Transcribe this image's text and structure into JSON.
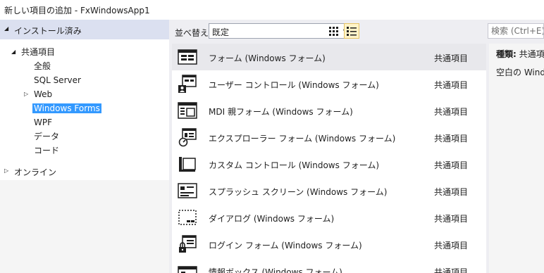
{
  "window": {
    "title": "新しい項目の追加 - FxWindowsApp1"
  },
  "left": {
    "installed_label": "インストール済み",
    "tree": [
      {
        "label": "共通項目",
        "expander": "◢"
      },
      {
        "label": "全般"
      },
      {
        "label": "SQL Server"
      },
      {
        "label": "Web",
        "expander": "▷"
      },
      {
        "label": "Windows Forms",
        "selected": true
      },
      {
        "label": "WPF"
      },
      {
        "label": "データ"
      },
      {
        "label": "コード"
      }
    ],
    "online_label": "オンライン"
  },
  "toolbar": {
    "sort_label": "並べ替え:",
    "sort_value": "既定",
    "search_placeholder": "検索 (Ctrl+E)",
    "views": [
      {
        "icon": "grid-view-icon"
      },
      {
        "icon": "list-view-icon",
        "active": true
      }
    ]
  },
  "templates": [
    {
      "name": "フォーム (Windows フォーム)",
      "category": "共通項目",
      "icon": "form-icon",
      "selected": true
    },
    {
      "name": "ユーザー コントロール (Windows フォーム)",
      "category": "共通項目",
      "icon": "user-control-icon"
    },
    {
      "name": "MDI 親フォーム (Windows フォーム)",
      "category": "共通項目",
      "icon": "mdi-parent-form-icon"
    },
    {
      "name": "エクスプローラー フォーム (Windows フォーム)",
      "category": "共通項目",
      "icon": "explorer-form-icon"
    },
    {
      "name": "カスタム コントロール (Windows フォーム)",
      "category": "共通項目",
      "icon": "custom-control-icon"
    },
    {
      "name": "スプラッシュ スクリーン (Windows フォーム)",
      "category": "共通項目",
      "icon": "splash-screen-icon"
    },
    {
      "name": "ダイアログ (Windows フォーム)",
      "category": "共通項目",
      "icon": "dialog-icon"
    },
    {
      "name": "ログイン フォーム (Windows フォーム)",
      "category": "共通項目",
      "icon": "login-form-icon"
    },
    {
      "name": "情報ボックス (Windows フォーム)",
      "category": "共通項目",
      "icon": "about-box-icon"
    }
  ],
  "details": {
    "type_label": "種類:",
    "type_value": "共通項",
    "description": "空白の Windo"
  }
}
